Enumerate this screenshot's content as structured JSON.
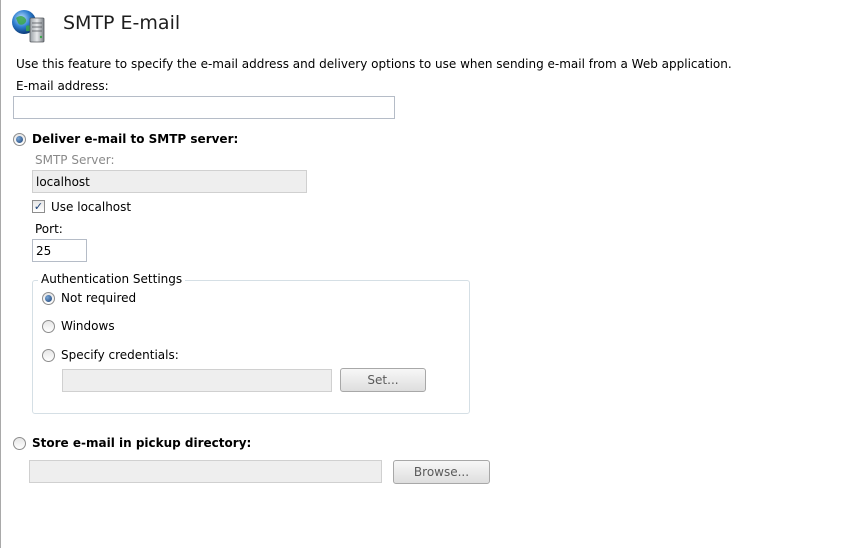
{
  "page": {
    "title": "SMTP E-mail",
    "description": "Use this feature to specify the e-mail address and delivery options to use when sending e-mail from a Web application.",
    "icon": "globe-server-icon"
  },
  "email": {
    "label": "E-mail address:",
    "value": ""
  },
  "delivery": {
    "smtp_option_label": "Deliver e-mail to SMTP server:",
    "smtp_selected": true,
    "smtp_server_label": "SMTP Server:",
    "smtp_server_value": "localhost",
    "use_localhost_label": "Use localhost",
    "use_localhost_checked": true,
    "port_label": "Port:",
    "port_value": "25",
    "pickup_option_label": "Store e-mail in pickup directory:",
    "pickup_selected": false,
    "pickup_directory_value": "",
    "browse_button_label": "Browse..."
  },
  "authentication": {
    "group_label": "Authentication Settings",
    "options": [
      {
        "label": "Not required",
        "selected": true
      },
      {
        "label": "Windows",
        "selected": false
      },
      {
        "label": "Specify credentials:",
        "selected": false
      }
    ],
    "credentials_value": "",
    "set_button_label": "Set..."
  },
  "colors": {
    "accent": "#1a3f74",
    "disabled_bg": "#eeeeee",
    "border": "#b5bcc7"
  }
}
